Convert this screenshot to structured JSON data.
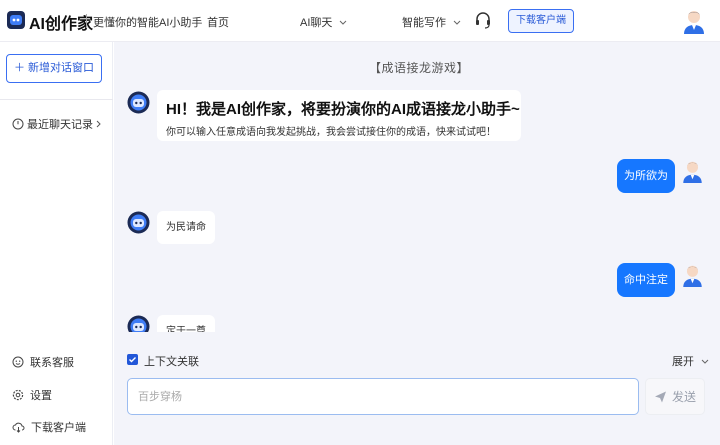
{
  "header": {
    "brand": "AI创作家",
    "slogan": "更懂你的智能AI小助手",
    "nav": {
      "home": "首页",
      "chat": "AI聊天",
      "write": "智能写作"
    },
    "download_button": "下载客户端"
  },
  "sidebar": {
    "new_chat": "＋ 新增对话窗口",
    "recent": "最近聊天记录",
    "contact": "联系客服",
    "settings": "设置",
    "download": "下载客户端"
  },
  "chat": {
    "game_title": "【成语接龙游戏】",
    "greeting_title": "HI！我是AI创作家，将要扮演你的AI成语接龙小助手~",
    "greeting_sub": "你可以输入任意成语向我发起挑战，我会尝试接住你的成语，快来试试吧！",
    "messages": [
      {
        "role": "user",
        "text": "为所欲为"
      },
      {
        "role": "bot",
        "text": "为民请命"
      },
      {
        "role": "user",
        "text": "命中注定"
      },
      {
        "role": "bot",
        "text": "定于一尊"
      }
    ]
  },
  "composer": {
    "context_label": "上下文关联",
    "context_checked": true,
    "expand_label": "展开",
    "placeholder": "百步穿杨",
    "send_label": "发送"
  },
  "colors": {
    "accent": "#1677ff",
    "border_accent": "#3a6ff2",
    "main_bg": "#f3f4fa"
  }
}
